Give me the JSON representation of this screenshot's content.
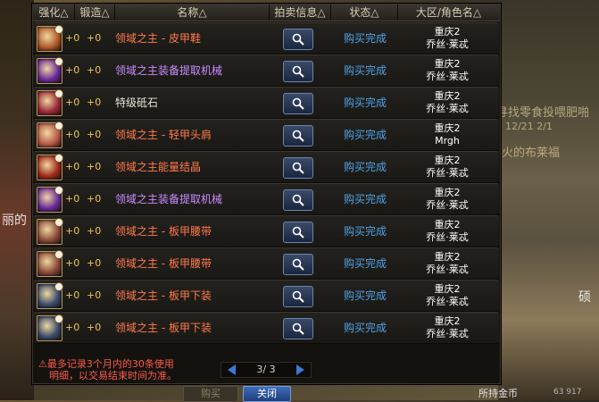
{
  "background": {
    "text1": "寻找零食投喂肥啪",
    "text2": "12/21  2/1",
    "text3": "火的布莱福",
    "text4": "丽的",
    "text5": "硕",
    "text6": "所持金币",
    "text7": "63 917"
  },
  "columns": {
    "enhance": "强化△",
    "forge": "锻造△",
    "name": "名称△",
    "auction": "拍卖信息△",
    "status": "状态△",
    "region": "大区/角色名△"
  },
  "rows": [
    {
      "icon": "boots-icon",
      "enhance": "+0",
      "forge": "+0",
      "name": "领域之主 - 皮甲鞋",
      "name_color": "#ff7a4a",
      "status": "购买完成",
      "server": "重庆2",
      "player": "乔丝·莱忒",
      "icon_color": "#b05a2a"
    },
    {
      "icon": "extractor-icon",
      "enhance": "+0",
      "forge": "+0",
      "name": "领域之主装备提取机械",
      "name_color": "#c78cff",
      "status": "购买完成",
      "server": "重庆2",
      "player": "乔丝·莱忒",
      "icon_color": "#6a2a9a"
    },
    {
      "icon": "gem-icon",
      "enhance": "+0",
      "forge": "+0",
      "name": "特级砥石",
      "name_color": "#e8e4d8",
      "status": "购买完成",
      "server": "重庆2",
      "player": "乔丝·莱忒",
      "icon_color": "#9a2a3a"
    },
    {
      "icon": "shoulder-icon",
      "enhance": "+0",
      "forge": "+0",
      "name": "领域之主 - 轻甲头肩",
      "name_color": "#ff7a4a",
      "status": "购买完成",
      "server": "重庆2",
      "player": "Mrgh",
      "icon_color": "#b85a4a"
    },
    {
      "icon": "crystal-icon",
      "enhance": "+0",
      "forge": "+0",
      "name": "领域之主能量结晶",
      "name_color": "#ff7a4a",
      "status": "购买完成",
      "server": "重庆2",
      "player": "乔丝·莱忒",
      "icon_color": "#a02a1a"
    },
    {
      "icon": "extractor-icon",
      "enhance": "+0",
      "forge": "+0",
      "name": "领域之主装备提取机械",
      "name_color": "#c78cff",
      "status": "购买完成",
      "server": "重庆2",
      "player": "乔丝·莱忒",
      "icon_color": "#6a2a9a"
    },
    {
      "icon": "belt-icon",
      "enhance": "+0",
      "forge": "+0",
      "name": "领域之主 - 板甲腰带",
      "name_color": "#ff7a4a",
      "status": "购买完成",
      "server": "重庆2",
      "player": "乔丝·莱忒",
      "icon_color": "#8a4a3a"
    },
    {
      "icon": "belt-icon",
      "enhance": "+0",
      "forge": "+0",
      "name": "领域之主 - 板甲腰带",
      "name_color": "#ff7a4a",
      "status": "购买完成",
      "server": "重庆2",
      "player": "乔丝·莱忒",
      "icon_color": "#8a4a3a"
    },
    {
      "icon": "pants-icon",
      "enhance": "+0",
      "forge": "+0",
      "name": "领域之主 - 板甲下装",
      "name_color": "#ff7a4a",
      "status": "购买完成",
      "server": "重庆2",
      "player": "乔丝·莱忒",
      "icon_color": "#3a4a6a"
    },
    {
      "icon": "pants-icon",
      "enhance": "+0",
      "forge": "+0",
      "name": "领域之主 - 板甲下装",
      "name_color": "#ff7a4a",
      "status": "购买完成",
      "server": "重庆2",
      "player": "乔丝·莱忒",
      "icon_color": "#3a4a6a"
    }
  ],
  "footer": {
    "note_line1": "最多记录3个月内的30条使用",
    "note_line2": "明细，以交易结束时间为准。",
    "page": "3/ 3",
    "buy_button": "购买",
    "close_button": "关闭"
  }
}
